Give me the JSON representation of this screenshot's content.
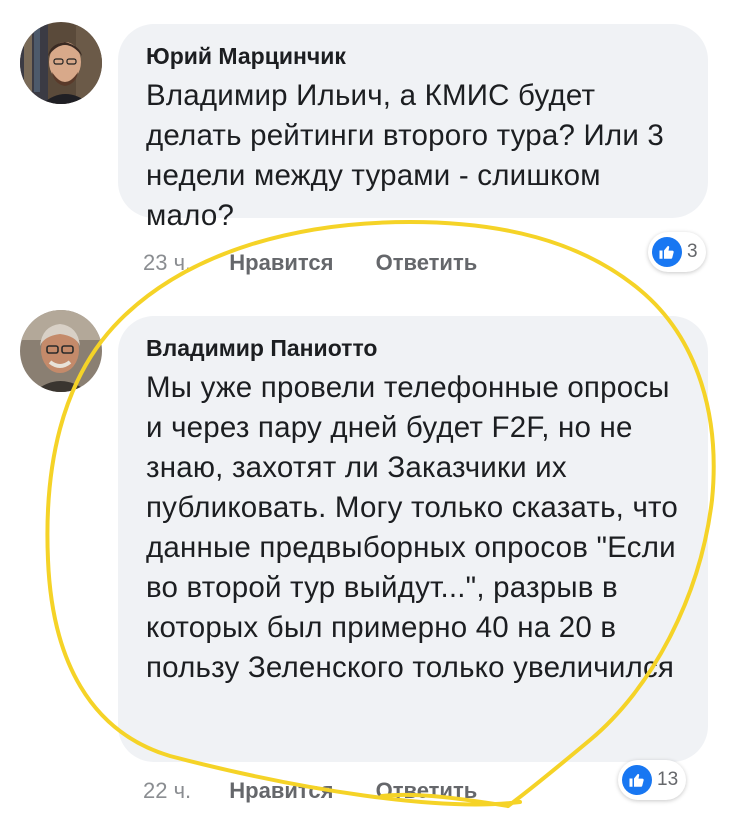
{
  "comments": [
    {
      "author": "Юрий Марцинчик",
      "text": "Владимир Ильич, а КМИС будет делать рейтинги второго тура? Или 3 недели между турами - слишком мало?",
      "time": "23 ч.",
      "like_label": "Нравится",
      "reply_label": "Ответить",
      "reaction_count": "3",
      "reaction_icon": "like-icon"
    },
    {
      "author": "Владимир Паниотто",
      "text": "Мы уже провели телефонные опросы и через пару дней будет F2F, но не знаю, захотят ли Заказчики их публиковать.  Могу только сказать, что данные предвыборных опросов \"Если во второй тур выйдут...\", разрыв в которых был примерно 40 на 20 в пользу Зеленского только увеличился",
      "time": "22 ч.",
      "like_label": "Нравится",
      "reply_label": "Ответить",
      "reaction_count": "13",
      "reaction_icon": "like-icon"
    }
  ],
  "colors": {
    "bubble": "#f0f2f5",
    "like_blue": "#1877f2",
    "annotation_yellow": "#f5d327",
    "meta_gray": "#65676b"
  }
}
